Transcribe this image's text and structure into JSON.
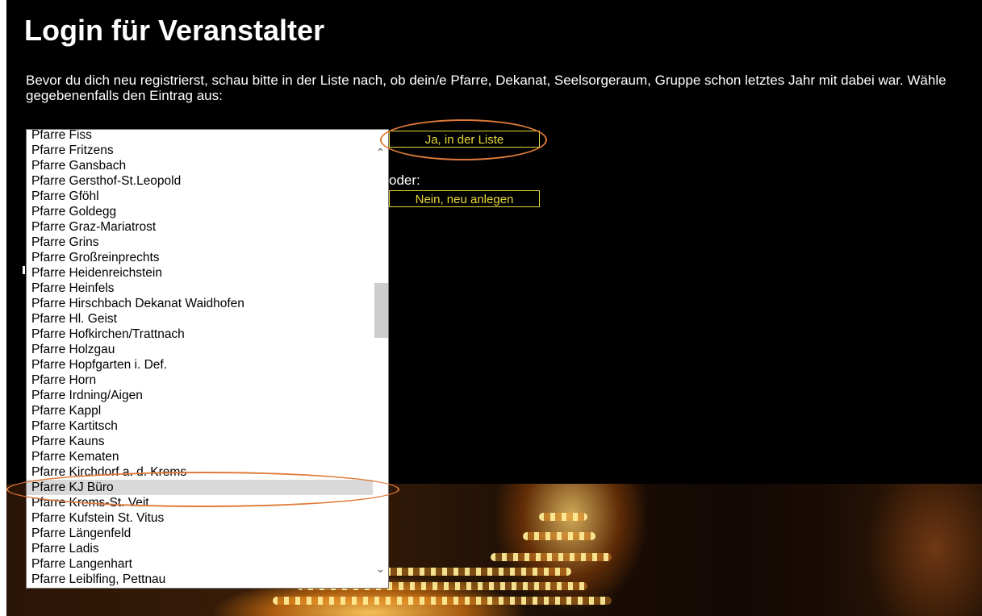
{
  "title": "Login für Veranstalter",
  "intro": "Bevor du dich neu registrierst, schau bitte in der Liste nach, ob dein/e Pfarre, Dekanat, Seelsorgeraum, Gruppe schon letztes Jahr mit dabei war. Wähle gegebenenfalls den Eintrag aus:",
  "list": {
    "items": [
      "Pfarre Fiss",
      "Pfarre Fritzens",
      "Pfarre Gansbach",
      "Pfarre Gersthof-St.Leopold",
      "Pfarre Gföhl",
      "Pfarre Goldegg",
      "Pfarre Graz-Mariatrost",
      "Pfarre Grins",
      "Pfarre Großreinprechts",
      "Pfarre Heidenreichstein",
      "Pfarre Heinfels",
      "Pfarre Hirschbach Dekanat Waidhofen",
      "Pfarre Hl. Geist",
      "Pfarre Hofkirchen/Trattnach",
      "Pfarre Holzgau",
      "Pfarre Hopfgarten i. Def.",
      "Pfarre Horn",
      "Pfarre Irdning/Aigen",
      "Pfarre Kappl",
      "Pfarre Kartitsch",
      "Pfarre Kauns",
      "Pfarre Kematen",
      "Pfarre Kirchdorf a. d. Krems",
      "Pfarre KJ Büro",
      "Pfarre Krems-St. Veit",
      "Pfarre Kufstein St. Vitus",
      "Pfarre Längenfeld",
      "Pfarre Ladis",
      "Pfarre Langenhart",
      "Pfarre Leiblfing, Pettnau"
    ],
    "selected": "Pfarre KJ Büro"
  },
  "buttons": {
    "yes": "Ja, in der Liste",
    "or": "oder:",
    "no": "Nein, neu anlegen"
  },
  "icons": {
    "scroll_up": "chevron-up-icon",
    "scroll_down": "chevron-down-icon"
  },
  "colors": {
    "button_accent": "#e8d83a",
    "highlight_ring": "#e07b39",
    "selected_row": "#d9d9d9"
  }
}
